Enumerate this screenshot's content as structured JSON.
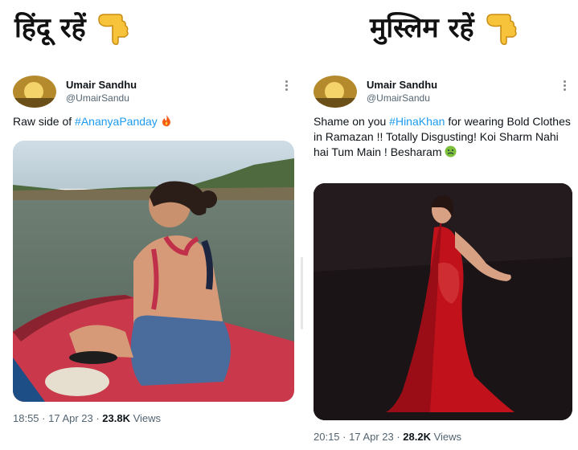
{
  "headings": {
    "left": "हिंदू रहें",
    "right": "मुस्लिम रहें",
    "pointing_icon": "backhand-index-pointing-down-emoji"
  },
  "tweets": [
    {
      "name": "Umair Sandhu",
      "handle": "@UmairSandu",
      "text_before": "Raw side of ",
      "hashtag": "#AnanyaPanday",
      "text_after": " ",
      "emoji_icon": "fire-emoji",
      "media_icon": "photo-woman-on-boat",
      "time": "18:55 · 17 Apr 23 · ",
      "views_count": "23.8K",
      "views_label": " Views"
    },
    {
      "name": "Umair Sandhu",
      "handle": "@UmairSandu",
      "text_before": "Shame on you ",
      "hashtag": "#HinaKhan",
      "text_after": " for wearing Bold Clothes in Ramazan !! Totally Disgusting! Koi Sharm Nahi hai Tum Main ! Besharam ",
      "emoji_icon": "nauseated-face-emoji",
      "media_icon": "photo-woman-red-gown",
      "time": "20:15 · 17 Apr 23 · ",
      "views_count": "28.2K",
      "views_label": " Views"
    }
  ],
  "colors": {
    "hashtag": "#1d9bf0",
    "secondary_text": "#536471",
    "primary_text": "#0f1419"
  }
}
